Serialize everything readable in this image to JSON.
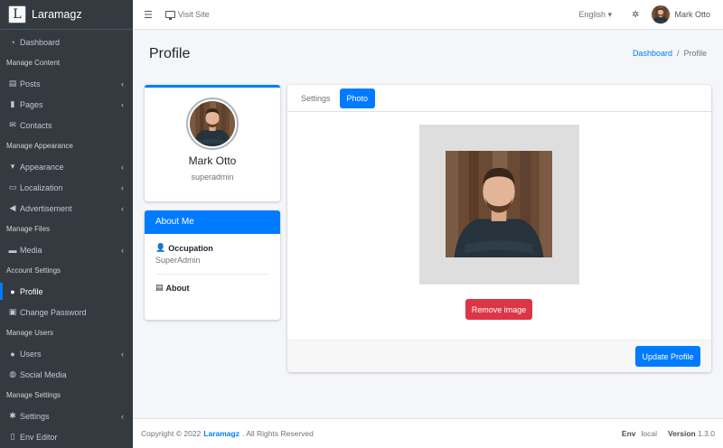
{
  "brand": {
    "logo_letter": "L",
    "name": "Laramagz"
  },
  "sidebar": {
    "items": [
      {
        "type": "item",
        "icon": "dashboard-icon",
        "glyph": "◔",
        "label": "Dashboard",
        "arrow": false
      },
      {
        "type": "header",
        "label": "Manage Content"
      },
      {
        "type": "item",
        "icon": "posts-icon",
        "glyph": "▤",
        "label": "Posts",
        "arrow": true
      },
      {
        "type": "item",
        "icon": "pages-icon",
        "glyph": "▮",
        "label": "Pages",
        "arrow": true
      },
      {
        "type": "item",
        "icon": "contacts-icon",
        "glyph": "✉",
        "label": "Contacts",
        "arrow": false
      },
      {
        "type": "header",
        "label": "Manage Appearance"
      },
      {
        "type": "item",
        "icon": "appearance-icon",
        "glyph": "▾",
        "label": "Appearance",
        "arrow": true
      },
      {
        "type": "item",
        "icon": "localization-icon",
        "glyph": "▭",
        "label": "Localization",
        "arrow": true
      },
      {
        "type": "item",
        "icon": "advertisement-icon",
        "glyph": "◀",
        "label": "Advertisement",
        "arrow": true
      },
      {
        "type": "header",
        "label": "Manage Files"
      },
      {
        "type": "item",
        "icon": "media-icon",
        "glyph": "▬",
        "label": "Media",
        "arrow": true
      },
      {
        "type": "header",
        "label": "Account Settings"
      },
      {
        "type": "item",
        "icon": "user-icon",
        "glyph": "●",
        "label": "Profile",
        "arrow": false,
        "active": true
      },
      {
        "type": "item",
        "icon": "lock-icon",
        "glyph": "▣",
        "label": "Change Password",
        "arrow": false
      },
      {
        "type": "header",
        "label": "Manage Users"
      },
      {
        "type": "item",
        "icon": "users-icon",
        "glyph": "●",
        "label": "Users",
        "arrow": true
      },
      {
        "type": "item",
        "icon": "globe-icon",
        "glyph": "◍",
        "label": "Social Media",
        "arrow": false
      },
      {
        "type": "header",
        "label": "Manage Settings"
      },
      {
        "type": "item",
        "icon": "settings-icon",
        "glyph": "✱",
        "label": "Settings",
        "arrow": true
      },
      {
        "type": "item",
        "icon": "file-icon",
        "glyph": "▯",
        "label": "Env Editor",
        "arrow": false
      }
    ]
  },
  "topbar": {
    "visit_site": "Visit Site",
    "language": "English",
    "user_name": "Mark Otto"
  },
  "page": {
    "title": "Profile",
    "breadcrumb_home": "Dashboard",
    "breadcrumb_current": "Profile"
  },
  "profile": {
    "name": "Mark Otto",
    "username": "superadmin"
  },
  "about": {
    "title": "About Me",
    "occupation_label": "Occupation",
    "occupation_value": "SuperAdmin",
    "about_label": "About"
  },
  "tabs": {
    "settings": "Settings",
    "photo": "Photo"
  },
  "photo": {
    "remove_label": "Remove image",
    "update_label": "Update Profile"
  },
  "footer": {
    "copyright_prefix": "Copyright © 2022",
    "brand": "Laramagz",
    "rights": ". All Rights Reserved",
    "env_label": "Env",
    "env_value": "local",
    "version_label": "Version",
    "version_value": "1.3.0"
  },
  "colors": {
    "primary": "#007bff",
    "danger": "#dc3545",
    "sidebar_bg": "#343a40"
  }
}
